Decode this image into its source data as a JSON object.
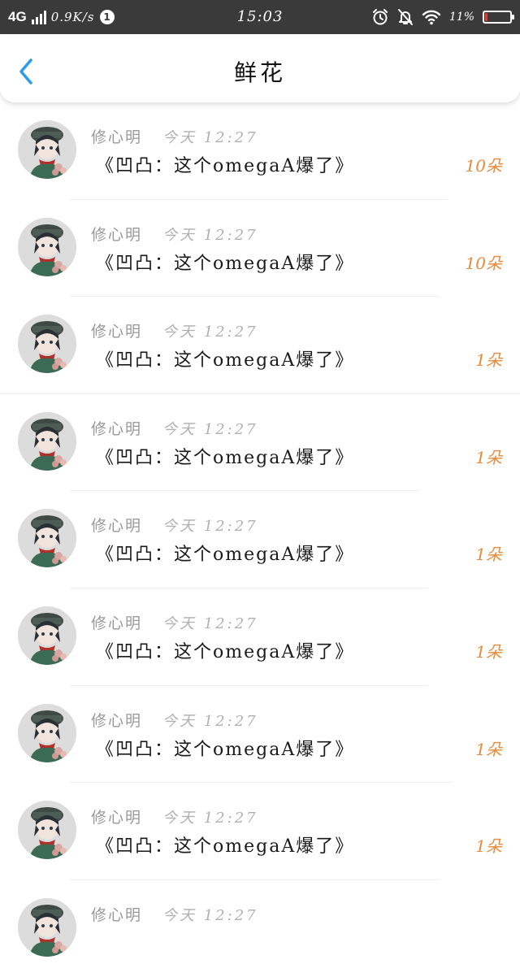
{
  "status_bar": {
    "network": "4G",
    "speed": "0.9K/s",
    "notification_count": "1",
    "time": "15:03",
    "battery_percent": "11%",
    "battery_level": 0.11,
    "icons": [
      "signal-icon",
      "alarm-icon",
      "mute-icon",
      "wifi-icon",
      "battery-icon"
    ]
  },
  "header": {
    "title": "鲜花",
    "back_icon": "chevron-left-icon",
    "accent_color": "#2f9be6"
  },
  "list": [
    {
      "name": "修心明",
      "time": "今天  12:27",
      "message": "《凹凸：这个omegaA爆了》",
      "count": "10朵"
    },
    {
      "name": "修心明",
      "time": "今天  12:27",
      "message": "《凹凸：这个omegaA爆了》",
      "count": "10朵"
    },
    {
      "name": "修心明",
      "time": "今天  12:27",
      "message": "《凹凸：这个omegaA爆了》",
      "count": "1朵"
    },
    {
      "name": "修心明",
      "time": "今天  12:27",
      "message": "《凹凸：这个omegaA爆了》",
      "count": "1朵"
    },
    {
      "name": "修心明",
      "time": "今天  12:27",
      "message": "《凹凸：这个omegaA爆了》",
      "count": "1朵"
    },
    {
      "name": "修心明",
      "time": "今天  12:27",
      "message": "《凹凸：这个omegaA爆了》",
      "count": "1朵"
    },
    {
      "name": "修心明",
      "time": "今天  12:27",
      "message": "《凹凸：这个omegaA爆了》",
      "count": "1朵"
    },
    {
      "name": "修心明",
      "time": "今天  12:27",
      "message": "《凹凸：这个omegaA爆了》",
      "count": "1朵"
    },
    {
      "name": "修心明",
      "time": "今天  12:27",
      "message": "",
      "count": ""
    }
  ],
  "colors": {
    "count": "#e98a3a",
    "name": "#9a9a9a",
    "status_bar_bg": "#3a3a3a"
  }
}
